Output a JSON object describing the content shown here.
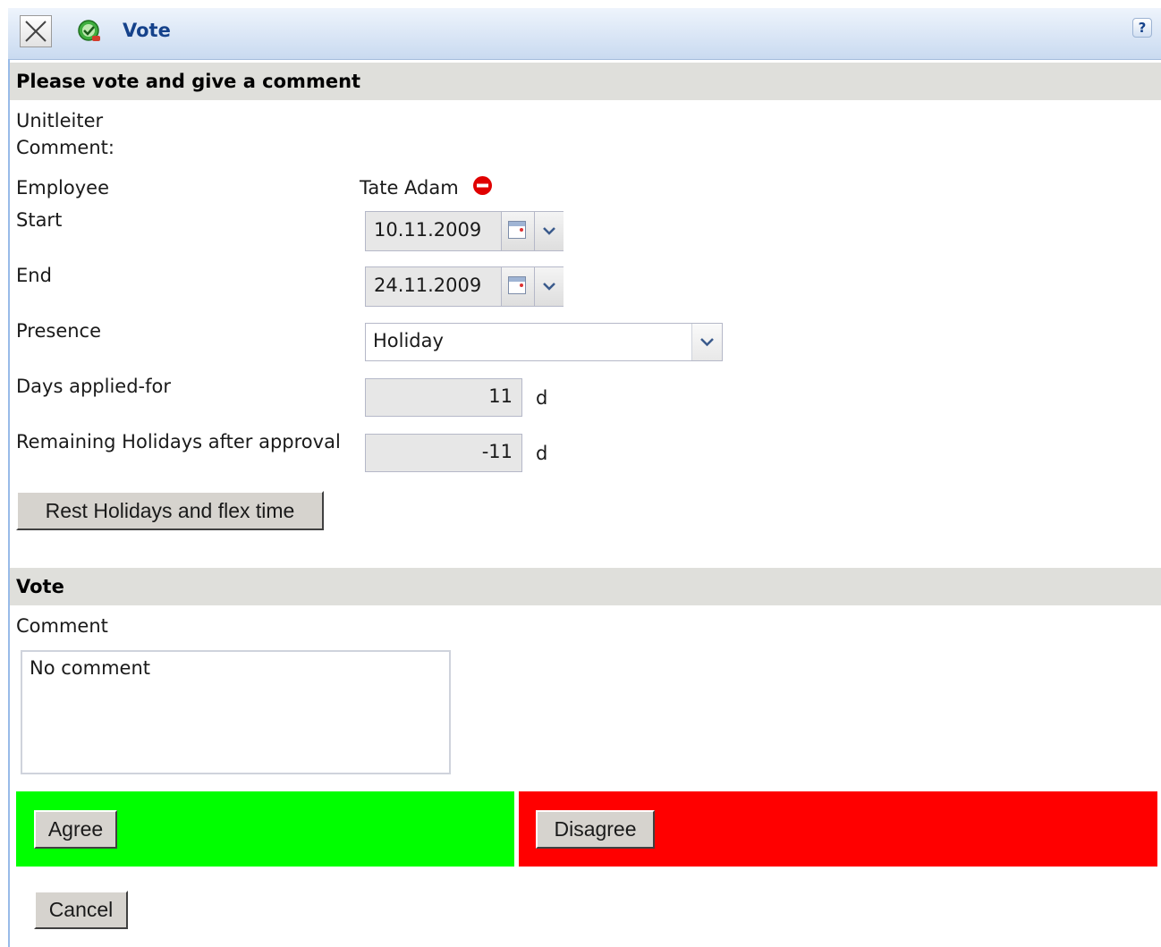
{
  "window": {
    "title": "Vote",
    "help_label": "?",
    "close_icon": "close-x-icon",
    "app_icon": "vote-check-icon"
  },
  "info_section": {
    "header": "Please vote and give a comment",
    "unitleiter_label": "Unitleiter",
    "comment_label": "Comment:",
    "employee_label": "Employee",
    "employee_value": "Tate Adam",
    "employee_status_icon": "remove-red-icon",
    "start_label": "Start",
    "start_value": "10.11.2009",
    "end_label": "End",
    "end_value": "24.11.2009",
    "presence_label": "Presence",
    "presence_value": "Holiday",
    "days_label": "Days applied-for",
    "days_value": "11",
    "days_unit": "d",
    "remaining_label": "Remaining Holidays after approval",
    "remaining_value": "-11",
    "remaining_unit": "d",
    "rest_button": "Rest Holidays and flex time"
  },
  "vote_section": {
    "header": "Vote",
    "comment_label": "Comment",
    "comment_value": "No comment",
    "agree_button": "Agree",
    "disagree_button": "Disagree",
    "cancel_button": "Cancel",
    "agree_color": "#00ff00",
    "disagree_color": "#ff0000"
  }
}
